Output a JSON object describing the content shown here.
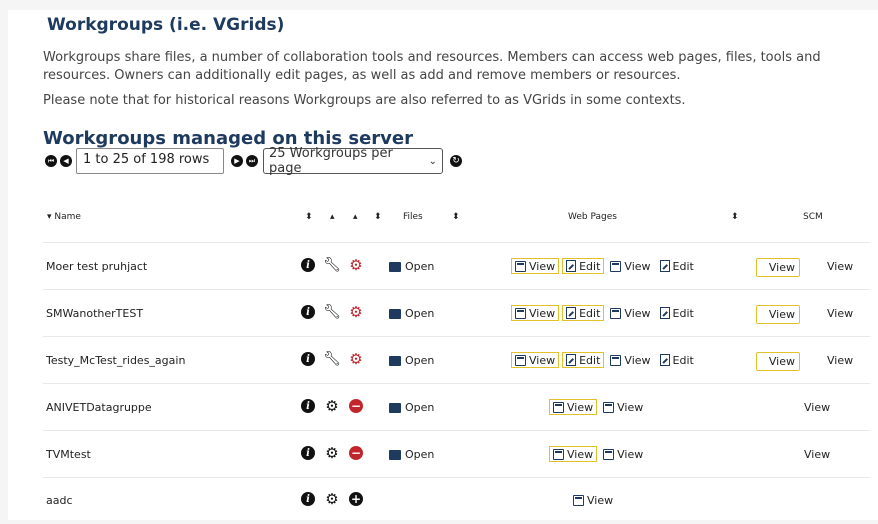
{
  "page": {
    "title": "Workgroups (i.e. VGrids)",
    "intro1": "Workgroups share files, a number of collaboration tools and resources. Members can access web pages, files, tools and resources. Owners can additionally edit pages, as well as add and remove members or resources.",
    "intro2": "Please note that for historical reasons Workgroups are also referred to as VGrids in some contexts.",
    "section_title": "Workgroups managed on this server"
  },
  "pager": {
    "display": "1 to 25 of 198 rows",
    "per_page": "25 Workgroups per page"
  },
  "table": {
    "headers": {
      "name": "Name",
      "files": "Files",
      "web_pages": "Web Pages",
      "scm": "SCM"
    },
    "rows": [
      {
        "name": "Moer test pruhjact",
        "files": "Open",
        "web": [
          "View",
          "Edit",
          "View",
          "Edit"
        ],
        "scm": [
          "View",
          "View"
        ]
      },
      {
        "name": "SMWanotherTEST",
        "files": "Open",
        "web": [
          "View",
          "Edit",
          "View",
          "Edit"
        ],
        "scm": [
          "View",
          "View"
        ]
      },
      {
        "name": "Testy_McTest_rides_again",
        "files": "Open",
        "web": [
          "View",
          "Edit",
          "View",
          "Edit"
        ],
        "scm": [
          "View",
          "View"
        ]
      },
      {
        "name": "ANIVETDatagruppe",
        "files": "Open",
        "web": [
          "View",
          "View"
        ],
        "scm": [
          "View"
        ]
      },
      {
        "name": "TVMtest",
        "files": "Open",
        "web": [
          "View",
          "View"
        ],
        "scm": [
          "View"
        ]
      },
      {
        "name": "aadc",
        "web": [
          "View"
        ]
      }
    ]
  },
  "icons": {
    "info": "info-icon",
    "admin": "wrench-icon",
    "settings": "gear-icon",
    "leave": "remove-icon",
    "join": "add-icon",
    "folder": "folder-icon",
    "page": "page-icon",
    "edit": "edit-icon"
  },
  "colors": {
    "heading": "#1e3a5f",
    "highlight_border": "#e2c12a",
    "danger": "#c0262b"
  }
}
